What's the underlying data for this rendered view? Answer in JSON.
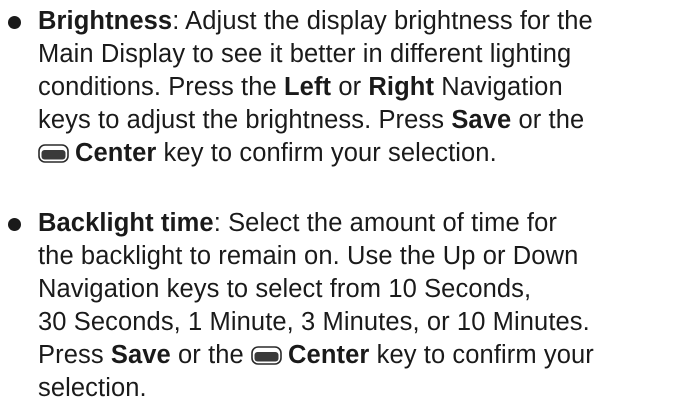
{
  "items": [
    {
      "lines": [
        {
          "b1": "Brightness",
          "t1": ": Adjust the display brightness for the"
        },
        {
          "t1": "Main Display to see it better in different lighting"
        },
        {
          "t1": "conditions. Press the ",
          "b1": "Left",
          "t2": " or ",
          "b2": "Right",
          "t3": " Navigation"
        },
        {
          "t1": "keys to adjust the brightness. Press ",
          "b1": "Save",
          "t2": " or the"
        },
        {
          "icon": "center-key-icon",
          "b1": "Center",
          "t1": " key to confirm your selection."
        }
      ]
    },
    {
      "lines": [
        {
          "b1": "Backlight time",
          "t1": ": Select the amount of time for"
        },
        {
          "t1": "the backlight to remain on. Use the Up or Down"
        },
        {
          "t1": "Navigation keys to select from 10 Seconds,"
        },
        {
          "t1": "30 Seconds, 1 Minute, 3 Minutes, or 10 Minutes."
        },
        {
          "t1": "Press ",
          "b1": "Save",
          "t2": " or the ",
          "icon": "center-key-icon",
          "b2": "Center",
          "t3": " key to confirm your"
        },
        {
          "t1": "selection."
        }
      ]
    }
  ],
  "colors": {
    "text": "#1a1a1a",
    "key_icon_fill": "#3a3a3a"
  }
}
